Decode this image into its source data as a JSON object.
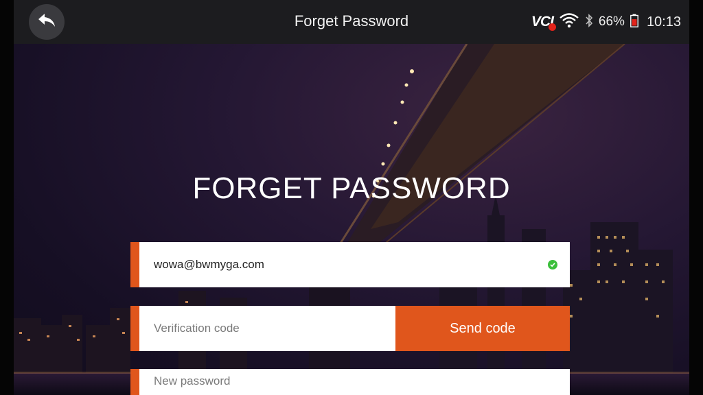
{
  "status_bar": {
    "vci_label": "VCI",
    "battery_percent": "66%",
    "time": "10:13"
  },
  "header": {
    "title": "Forget Password",
    "back_icon": "back-arrow-icon"
  },
  "main": {
    "headline": "FORGET PASSWORD",
    "email": {
      "value": "wowa@bwmyga.com",
      "valid_icon": "check-circle-icon"
    },
    "verification": {
      "placeholder": "Verification code",
      "send_label": "Send code"
    },
    "new_password": {
      "placeholder": "New password"
    }
  },
  "colors": {
    "accent": "#e0561c",
    "header_bg": "#1c1c1f",
    "valid": "#3bbf3b"
  }
}
